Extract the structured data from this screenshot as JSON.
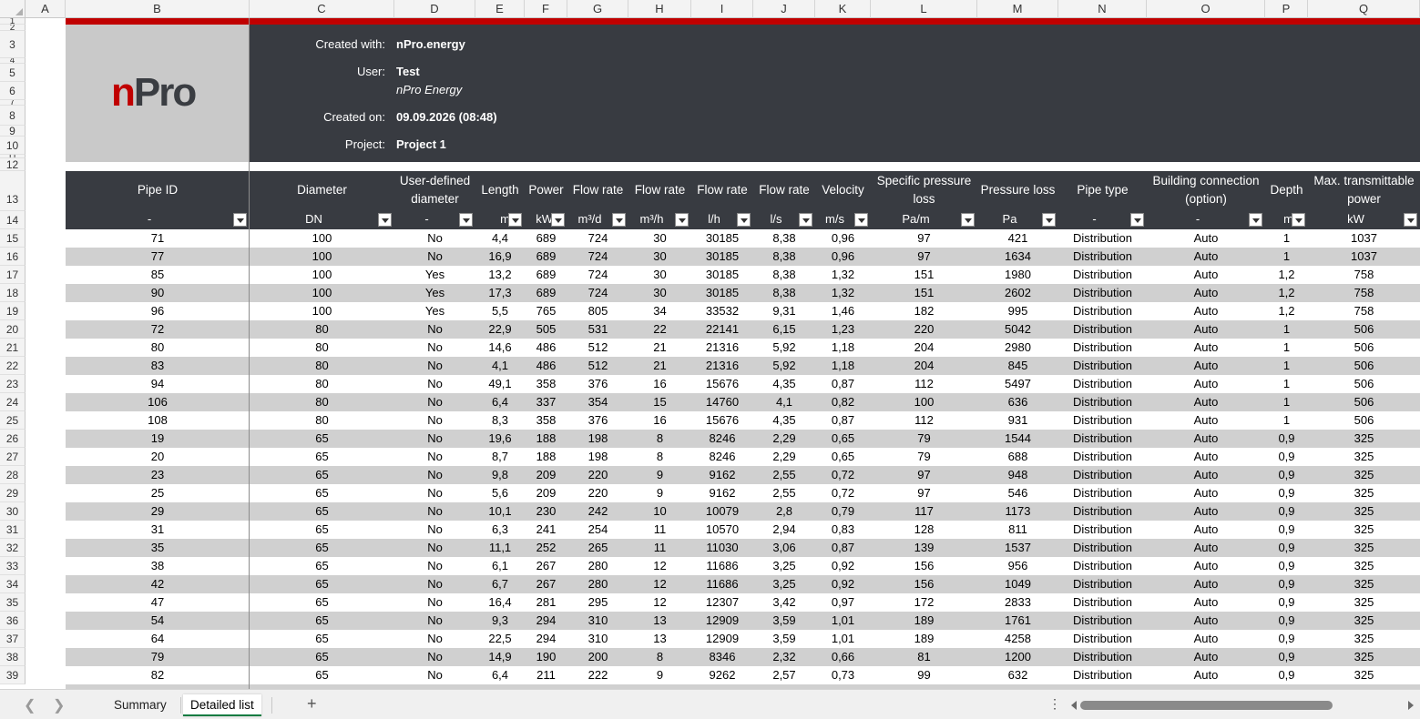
{
  "columns": [
    "A",
    "B",
    "C",
    "D",
    "E",
    "F",
    "G",
    "H",
    "I",
    "J",
    "K",
    "L",
    "M",
    "N",
    "O",
    "P",
    "Q"
  ],
  "row_numbers": [
    "1",
    "2",
    "3",
    "4",
    "5",
    "6",
    "7",
    "8",
    "9",
    "10",
    "11",
    "12",
    "13",
    "14",
    "15",
    "16",
    "17",
    "18",
    "19",
    "20",
    "21",
    "22",
    "23",
    "24",
    "25",
    "26",
    "27",
    "28",
    "29",
    "30",
    "31",
    "32",
    "33",
    "34",
    "35",
    "36",
    "37",
    "38",
    "39"
  ],
  "logo": {
    "n": "n",
    "pro": "Pro"
  },
  "info": {
    "created_with_label": "Created with:",
    "created_with_value": "nPro.energy",
    "user_label": "User:",
    "user_value": "Test",
    "user_company": "nPro Energy",
    "created_on_label": "Created on:",
    "created_on_value": "09.09.2026 (08:48)",
    "project_label": "Project:",
    "project_value": "Project 1"
  },
  "table": {
    "headers": [
      {
        "title": "Pipe ID",
        "unit": "-"
      },
      {
        "title": "Diameter",
        "unit": "DN"
      },
      {
        "title": "User-defined diameter",
        "unit": "-"
      },
      {
        "title": "Length",
        "unit": "m"
      },
      {
        "title": "Power",
        "unit": "kW"
      },
      {
        "title": "Flow rate",
        "unit": "m³/d"
      },
      {
        "title": "Flow rate",
        "unit": "m³/h"
      },
      {
        "title": "Flow rate",
        "unit": "l/h"
      },
      {
        "title": "Flow rate",
        "unit": "l/s"
      },
      {
        "title": "Velocity",
        "unit": "m/s"
      },
      {
        "title": "Specific pressure loss",
        "unit": "Pa/m"
      },
      {
        "title": "Pressure loss",
        "unit": "Pa"
      },
      {
        "title": "Pipe type",
        "unit": "-"
      },
      {
        "title": "Building connection (option)",
        "unit": "-"
      },
      {
        "title": "Depth",
        "unit": "m"
      },
      {
        "title": "Max. transmittable power",
        "unit": "kW"
      }
    ],
    "rows": [
      [
        "71",
        "100",
        "No",
        "4,4",
        "689",
        "724",
        "30",
        "30185",
        "8,38",
        "0,96",
        "97",
        "421",
        "Distribution",
        "Auto",
        "1",
        "1037"
      ],
      [
        "77",
        "100",
        "No",
        "16,9",
        "689",
        "724",
        "30",
        "30185",
        "8,38",
        "0,96",
        "97",
        "1634",
        "Distribution",
        "Auto",
        "1",
        "1037"
      ],
      [
        "85",
        "100",
        "Yes",
        "13,2",
        "689",
        "724",
        "30",
        "30185",
        "8,38",
        "1,32",
        "151",
        "1980",
        "Distribution",
        "Auto",
        "1,2",
        "758"
      ],
      [
        "90",
        "100",
        "Yes",
        "17,3",
        "689",
        "724",
        "30",
        "30185",
        "8,38",
        "1,32",
        "151",
        "2602",
        "Distribution",
        "Auto",
        "1,2",
        "758"
      ],
      [
        "96",
        "100",
        "Yes",
        "5,5",
        "765",
        "805",
        "34",
        "33532",
        "9,31",
        "1,46",
        "182",
        "995",
        "Distribution",
        "Auto",
        "1,2",
        "758"
      ],
      [
        "72",
        "80",
        "No",
        "22,9",
        "505",
        "531",
        "22",
        "22141",
        "6,15",
        "1,23",
        "220",
        "5042",
        "Distribution",
        "Auto",
        "1",
        "506"
      ],
      [
        "80",
        "80",
        "No",
        "14,6",
        "486",
        "512",
        "21",
        "21316",
        "5,92",
        "1,18",
        "204",
        "2980",
        "Distribution",
        "Auto",
        "1",
        "506"
      ],
      [
        "83",
        "80",
        "No",
        "4,1",
        "486",
        "512",
        "21",
        "21316",
        "5,92",
        "1,18",
        "204",
        "845",
        "Distribution",
        "Auto",
        "1",
        "506"
      ],
      [
        "94",
        "80",
        "No",
        "49,1",
        "358",
        "376",
        "16",
        "15676",
        "4,35",
        "0,87",
        "112",
        "5497",
        "Distribution",
        "Auto",
        "1",
        "506"
      ],
      [
        "106",
        "80",
        "No",
        "6,4",
        "337",
        "354",
        "15",
        "14760",
        "4,1",
        "0,82",
        "100",
        "636",
        "Distribution",
        "Auto",
        "1",
        "506"
      ],
      [
        "108",
        "80",
        "No",
        "8,3",
        "358",
        "376",
        "16",
        "15676",
        "4,35",
        "0,87",
        "112",
        "931",
        "Distribution",
        "Auto",
        "1",
        "506"
      ],
      [
        "19",
        "65",
        "No",
        "19,6",
        "188",
        "198",
        "8",
        "8246",
        "2,29",
        "0,65",
        "79",
        "1544",
        "Distribution",
        "Auto",
        "0,9",
        "325"
      ],
      [
        "20",
        "65",
        "No",
        "8,7",
        "188",
        "198",
        "8",
        "8246",
        "2,29",
        "0,65",
        "79",
        "688",
        "Distribution",
        "Auto",
        "0,9",
        "325"
      ],
      [
        "23",
        "65",
        "No",
        "9,8",
        "209",
        "220",
        "9",
        "9162",
        "2,55",
        "0,72",
        "97",
        "948",
        "Distribution",
        "Auto",
        "0,9",
        "325"
      ],
      [
        "25",
        "65",
        "No",
        "5,6",
        "209",
        "220",
        "9",
        "9162",
        "2,55",
        "0,72",
        "97",
        "546",
        "Distribution",
        "Auto",
        "0,9",
        "325"
      ],
      [
        "29",
        "65",
        "No",
        "10,1",
        "230",
        "242",
        "10",
        "10079",
        "2,8",
        "0,79",
        "117",
        "1173",
        "Distribution",
        "Auto",
        "0,9",
        "325"
      ],
      [
        "31",
        "65",
        "No",
        "6,3",
        "241",
        "254",
        "11",
        "10570",
        "2,94",
        "0,83",
        "128",
        "811",
        "Distribution",
        "Auto",
        "0,9",
        "325"
      ],
      [
        "35",
        "65",
        "No",
        "11,1",
        "252",
        "265",
        "11",
        "11030",
        "3,06",
        "0,87",
        "139",
        "1537",
        "Distribution",
        "Auto",
        "0,9",
        "325"
      ],
      [
        "38",
        "65",
        "No",
        "6,1",
        "267",
        "280",
        "12",
        "11686",
        "3,25",
        "0,92",
        "156",
        "956",
        "Distribution",
        "Auto",
        "0,9",
        "325"
      ],
      [
        "42",
        "65",
        "No",
        "6,7",
        "267",
        "280",
        "12",
        "11686",
        "3,25",
        "0,92",
        "156",
        "1049",
        "Distribution",
        "Auto",
        "0,9",
        "325"
      ],
      [
        "47",
        "65",
        "No",
        "16,4",
        "281",
        "295",
        "12",
        "12307",
        "3,42",
        "0,97",
        "172",
        "2833",
        "Distribution",
        "Auto",
        "0,9",
        "325"
      ],
      [
        "54",
        "65",
        "No",
        "9,3",
        "294",
        "310",
        "13",
        "12909",
        "3,59",
        "1,01",
        "189",
        "1761",
        "Distribution",
        "Auto",
        "0,9",
        "325"
      ],
      [
        "64",
        "65",
        "No",
        "22,5",
        "294",
        "310",
        "13",
        "12909",
        "3,59",
        "1,01",
        "189",
        "4258",
        "Distribution",
        "Auto",
        "0,9",
        "325"
      ],
      [
        "79",
        "65",
        "No",
        "14,9",
        "190",
        "200",
        "8",
        "8346",
        "2,32",
        "0,66",
        "81",
        "1200",
        "Distribution",
        "Auto",
        "0,9",
        "325"
      ],
      [
        "82",
        "65",
        "No",
        "6,4",
        "211",
        "222",
        "9",
        "9262",
        "2,57",
        "0,73",
        "99",
        "632",
        "Distribution",
        "Auto",
        "0,9",
        "325"
      ]
    ]
  },
  "tabs": {
    "summary": "Summary",
    "detailed": "Detailed list",
    "add": "+"
  },
  "colors": {
    "accent_red": "#c00000",
    "header_dark": "#383b41",
    "alt_row": "#d0d0d0",
    "excel_green": "#107c41"
  }
}
